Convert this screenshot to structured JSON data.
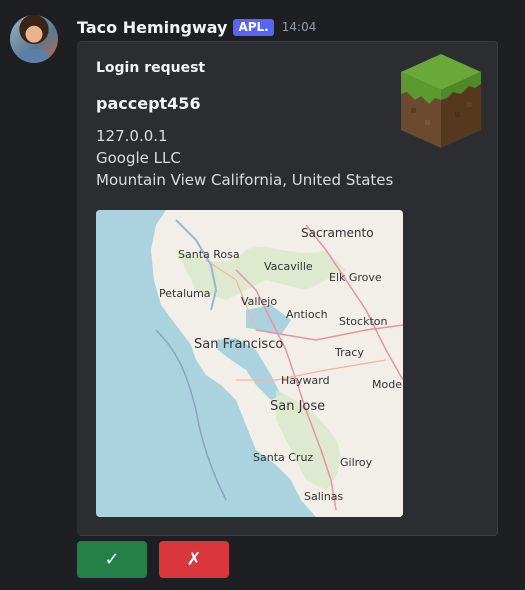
{
  "message": {
    "author": "Taco Hemingway",
    "badge": "APL.",
    "timestamp": "14:04"
  },
  "embed": {
    "title": "Login request",
    "username": "paccept456",
    "ip": "127.0.0.1",
    "org": "Google LLC",
    "location": "Mountain View California, United States"
  },
  "map": {
    "labels": {
      "sacramento": "Sacramento",
      "santa_rosa": "Santa Rosa",
      "vacaville": "Vacaville",
      "elk_grove": "Elk Grove",
      "petaluma": "Petaluma",
      "vallejo": "Vallejo",
      "antioch": "Antioch",
      "stockton": "Stockton",
      "san_francisco": "San Francisco",
      "tracy": "Tracy",
      "hayward": "Hayward",
      "modesto": "Mode",
      "san_jose": "San Jose",
      "santa_cruz": "Santa Cruz",
      "gilroy": "Gilroy",
      "salinas": "Salinas"
    }
  },
  "actions": {
    "accept_icon": "✓",
    "deny_icon": "✗"
  },
  "colors": {
    "accept": "#248046",
    "deny": "#da373c",
    "badge": "#5865f2"
  }
}
